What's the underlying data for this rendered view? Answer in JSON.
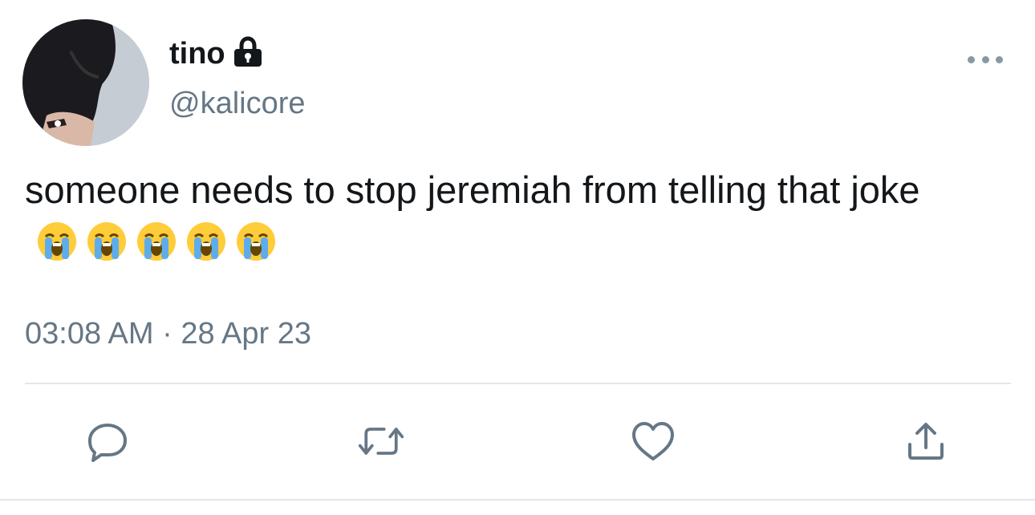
{
  "tweet": {
    "display_name": "tino",
    "handle": "@kalicore",
    "text": "someone needs to stop jeremiah from telling that joke",
    "emoji": [
      "loudly-crying-face",
      "loudly-crying-face",
      "loudly-crying-face",
      "loudly-crying-face",
      "loudly-crying-face"
    ],
    "timestamp": "03:08 AM · 28 Apr 23",
    "protected": true
  },
  "icons": {
    "lock": "lock-icon",
    "more": "more-horizontal-icon",
    "reply": "reply-icon",
    "retweet": "retweet-icon",
    "like": "heart-icon",
    "share": "share-icon"
  },
  "colors": {
    "text": "#14171a",
    "secondary": "#657786",
    "icon": "#657786",
    "divider": "#e1e8ed"
  }
}
